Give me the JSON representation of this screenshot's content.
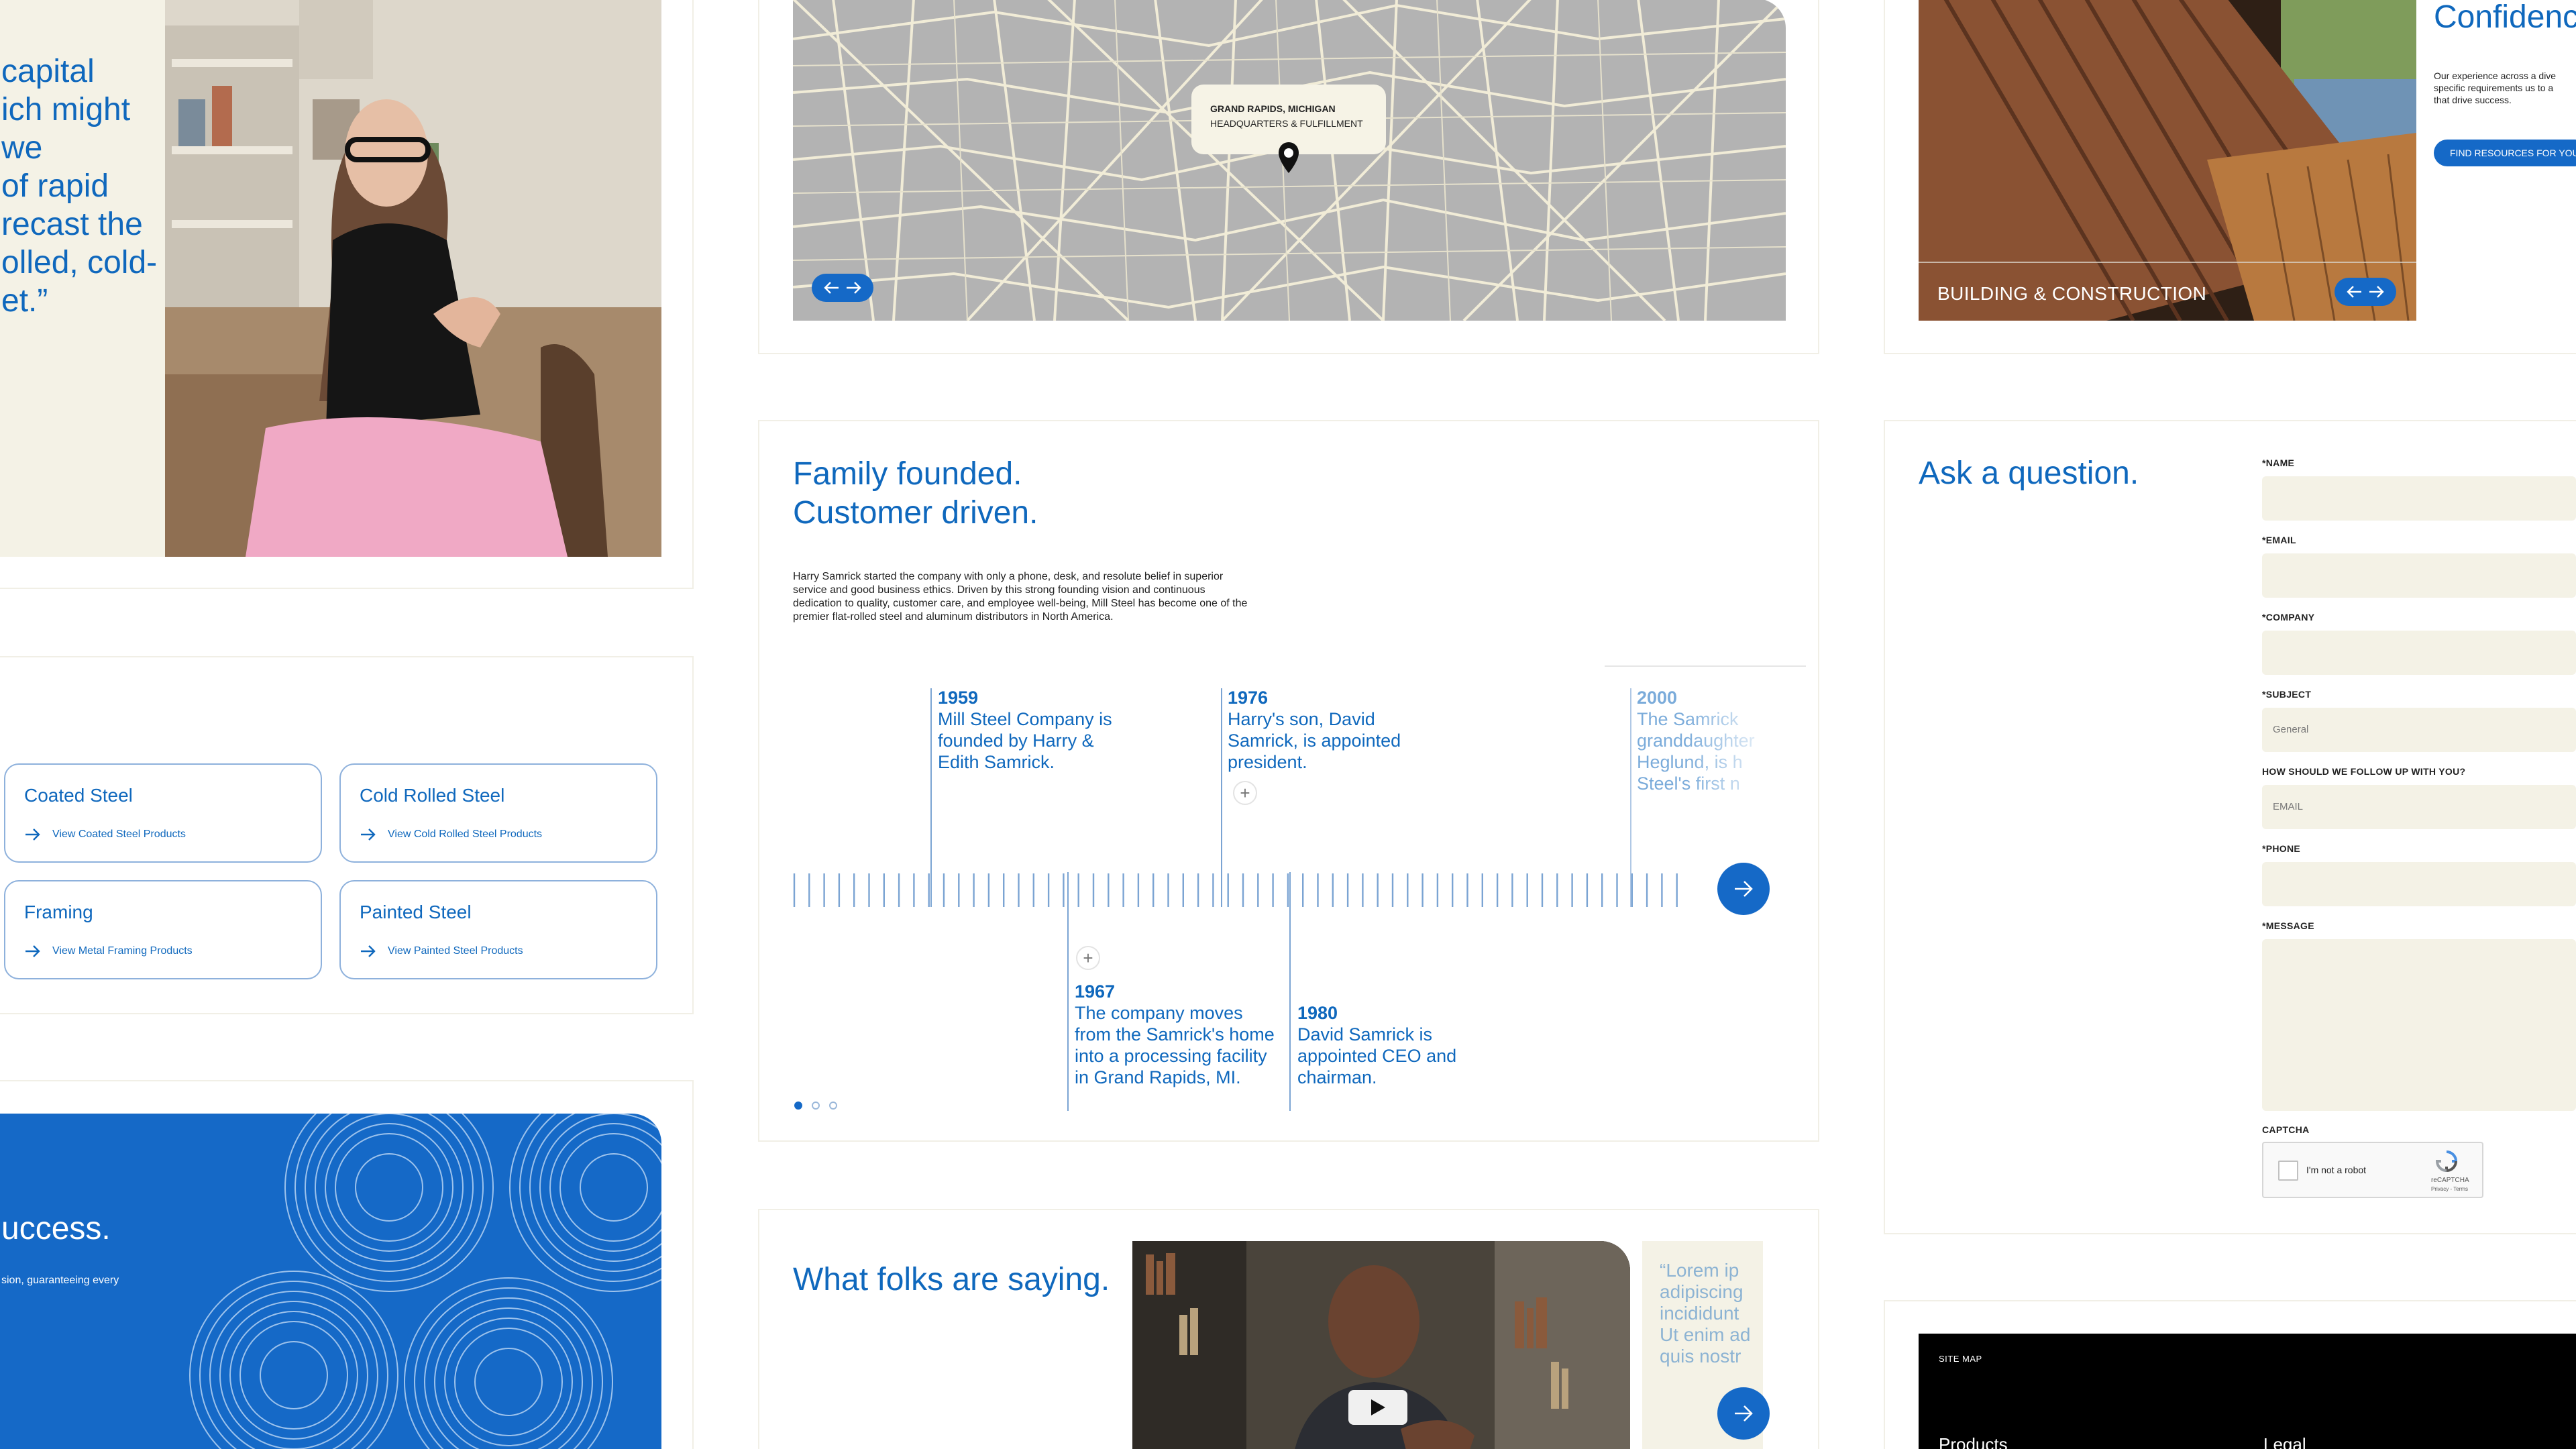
{
  "quote": {
    "lines": [
      "capital",
      "ich might",
      "we",
      "of rapid",
      "recast the",
      "olled, cold-",
      "et.”"
    ]
  },
  "map": {
    "city": "GRAND RAPIDS, MICHIGAN",
    "subtitle": "HEADQUARTERS & FULFILLMENT"
  },
  "industry": {
    "label": "BUILDING & CONSTRUCTION",
    "heading": "Confidenc",
    "body_lines": [
      "Our experience across a dive",
      "specific requirements us to a",
      "that drive success."
    ],
    "cta": "FIND RESOURCES FOR YOU"
  },
  "products": [
    {
      "title": "Coated Steel",
      "link": "View Coated Steel Products"
    },
    {
      "title": "Cold Rolled Steel",
      "link": "View Cold Rolled Steel Products"
    },
    {
      "title": "Framing",
      "link": "View Metal Framing Products"
    },
    {
      "title": "Painted Steel",
      "link": "View Painted Steel Products"
    }
  ],
  "history": {
    "heading_line1": "Family founded.",
    "heading_line2": "Customer driven.",
    "body_lines": [
      "Harry Samrick started the company with only a phone, desk, and resolute belief in superior",
      "service and good business ethics. Driven by this strong founding vision and continuous",
      "dedication to quality, customer care, and employee well-being, Mill Steel has become one of the",
      "premier flat-rolled steel and aluminum distributors in North America."
    ],
    "events": [
      {
        "year": "1959",
        "lines": [
          "Mill Steel Company is",
          "founded by Harry &",
          "Edith Samrick."
        ]
      },
      {
        "year": "1976",
        "lines": [
          "Harry's son, David",
          "Samrick, is appointed",
          "president."
        ]
      },
      {
        "year": "2000",
        "lines": [
          "The Samrick",
          "granddaughter",
          "Heglund, is h",
          "Steel's first n"
        ]
      },
      {
        "year": "1967",
        "lines": [
          "The company moves",
          "from the Samrick's home",
          "into a processing facility",
          "in Grand Rapids, MI."
        ]
      },
      {
        "year": "1980",
        "lines": [
          "David Samrick is",
          "appointed CEO and",
          "chairman."
        ]
      }
    ]
  },
  "contact": {
    "heading": "Ask a question.",
    "fields": {
      "name": "*NAME",
      "email": "*EMAIL",
      "company": "*COMPANY",
      "subject": "*SUBJECT",
      "subject_value": "General",
      "follow_up": "HOW SHOULD WE FOLLOW UP WITH YOU?",
      "follow_up_value": "EMAIL",
      "phone": "*PHONE",
      "message": "*MESSAGE",
      "captcha": "CAPTCHA"
    },
    "recaptcha": {
      "checkbox_label": "I'm not a robot",
      "brand": "reCAPTCHA",
      "links": "Privacy - Terms"
    }
  },
  "success": {
    "heading": "uccess.",
    "body": "sion, guaranteeing every"
  },
  "testimonials": {
    "heading": "What folks are saying.",
    "quote_lines": [
      "“Lorem ip",
      "adipiscing",
      "incididunt",
      "Ut enim ad",
      "quis nostr"
    ]
  },
  "footer": {
    "label": "SITE MAP",
    "col1": "Products",
    "col2": "Legal"
  },
  "colors": {
    "brand_blue": "#1569c7",
    "text_blue": "#0f68bd",
    "cream": "#f4f2e6"
  }
}
